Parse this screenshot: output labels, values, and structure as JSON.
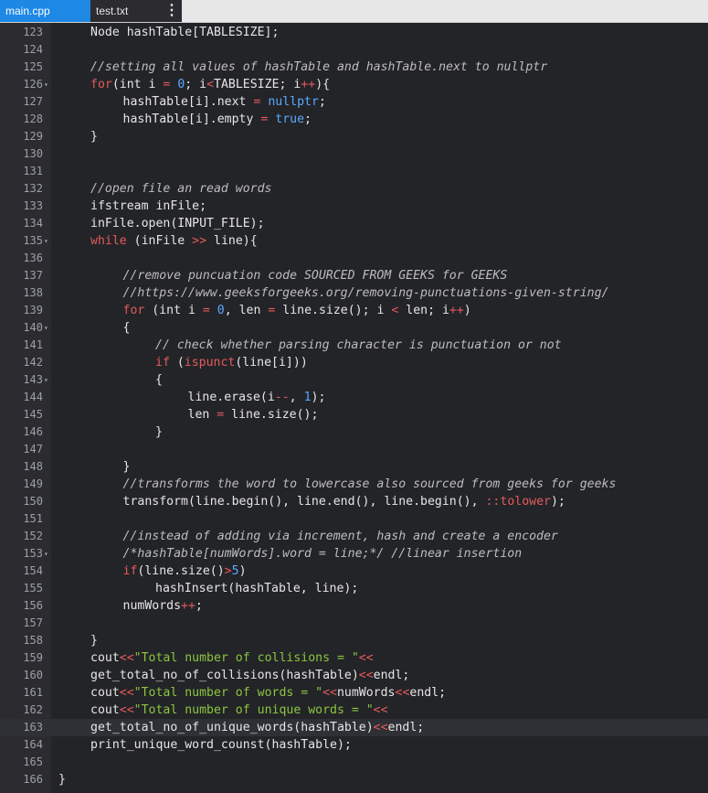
{
  "tabs": [
    {
      "label": "main.cpp",
      "active": true
    },
    {
      "label": "test.txt",
      "active": false
    }
  ],
  "tab_menu_icon": "kebab-menu-icon",
  "colors": {
    "active_tab": "#1e88e5",
    "editor_bg": "#232428",
    "gutter_bg": "#2c2c30",
    "keyword": "#e55a5a",
    "literal": "#5aa8ff",
    "string": "#8cc63e",
    "comment": "#bdbdbd"
  },
  "editor": {
    "active_line": 163,
    "lines": [
      {
        "n": "123",
        "fold": false,
        "indent": 1,
        "tokens": [
          {
            "t": "plain",
            "v": "Node hashTable[TABLESIZE];"
          }
        ]
      },
      {
        "n": "124",
        "fold": false,
        "indent": 0,
        "tokens": []
      },
      {
        "n": "125",
        "fold": false,
        "indent": 1,
        "tokens": [
          {
            "t": "com",
            "v": "//setting all values of hashTable and hashTable.next to nullptr"
          }
        ]
      },
      {
        "n": "126",
        "fold": true,
        "indent": 1,
        "tokens": [
          {
            "t": "kw",
            "v": "for"
          },
          {
            "t": "plain",
            "v": "(int i "
          },
          {
            "t": "op",
            "v": "="
          },
          {
            "t": "plain",
            "v": " "
          },
          {
            "t": "lit",
            "v": "0"
          },
          {
            "t": "plain",
            "v": "; i"
          },
          {
            "t": "op",
            "v": "<"
          },
          {
            "t": "plain",
            "v": "TABLESIZE; i"
          },
          {
            "t": "op",
            "v": "++"
          },
          {
            "t": "plain",
            "v": "){"
          }
        ]
      },
      {
        "n": "127",
        "fold": false,
        "indent": 2,
        "tokens": [
          {
            "t": "plain",
            "v": "hashTable[i].next "
          },
          {
            "t": "op",
            "v": "="
          },
          {
            "t": "plain",
            "v": " "
          },
          {
            "t": "lit",
            "v": "nullptr"
          },
          {
            "t": "plain",
            "v": ";"
          }
        ]
      },
      {
        "n": "128",
        "fold": false,
        "indent": 2,
        "tokens": [
          {
            "t": "plain",
            "v": "hashTable[i].empty "
          },
          {
            "t": "op",
            "v": "="
          },
          {
            "t": "plain",
            "v": " "
          },
          {
            "t": "lit",
            "v": "true"
          },
          {
            "t": "plain",
            "v": ";"
          }
        ]
      },
      {
        "n": "129",
        "fold": false,
        "indent": 1,
        "tokens": [
          {
            "t": "plain",
            "v": "}"
          }
        ]
      },
      {
        "n": "130",
        "fold": false,
        "indent": 0,
        "tokens": []
      },
      {
        "n": "131",
        "fold": false,
        "indent": 0,
        "tokens": []
      },
      {
        "n": "132",
        "fold": false,
        "indent": 1,
        "tokens": [
          {
            "t": "com",
            "v": "//open file an read words"
          }
        ]
      },
      {
        "n": "133",
        "fold": false,
        "indent": 1,
        "tokens": [
          {
            "t": "plain",
            "v": "ifstream inFile;"
          }
        ]
      },
      {
        "n": "134",
        "fold": false,
        "indent": 1,
        "tokens": [
          {
            "t": "plain",
            "v": "inFile.open(INPUT_FILE);"
          }
        ]
      },
      {
        "n": "135",
        "fold": true,
        "indent": 1,
        "tokens": [
          {
            "t": "kw",
            "v": "while"
          },
          {
            "t": "plain",
            "v": " (inFile "
          },
          {
            "t": "op",
            "v": ">>"
          },
          {
            "t": "plain",
            "v": " line){"
          }
        ]
      },
      {
        "n": "136",
        "fold": false,
        "indent": 0,
        "tokens": []
      },
      {
        "n": "137",
        "fold": false,
        "indent": 2,
        "tokens": [
          {
            "t": "com",
            "v": "//remove puncuation code SOURCED FROM GEEKS for GEEKS"
          }
        ]
      },
      {
        "n": "138",
        "fold": false,
        "indent": 2,
        "tokens": [
          {
            "t": "com",
            "v": "//https://www.geeksforgeeks.org/removing-punctuations-given-string/"
          }
        ]
      },
      {
        "n": "139",
        "fold": false,
        "indent": 2,
        "tokens": [
          {
            "t": "kw",
            "v": "for"
          },
          {
            "t": "plain",
            "v": " (int i "
          },
          {
            "t": "op",
            "v": "="
          },
          {
            "t": "plain",
            "v": " "
          },
          {
            "t": "lit",
            "v": "0"
          },
          {
            "t": "plain",
            "v": ", len "
          },
          {
            "t": "op",
            "v": "="
          },
          {
            "t": "plain",
            "v": " line.size(); i "
          },
          {
            "t": "op",
            "v": "<"
          },
          {
            "t": "plain",
            "v": " len; i"
          },
          {
            "t": "op",
            "v": "++"
          },
          {
            "t": "plain",
            "v": ")"
          }
        ]
      },
      {
        "n": "140",
        "fold": true,
        "indent": 2,
        "tokens": [
          {
            "t": "plain",
            "v": "{"
          }
        ]
      },
      {
        "n": "141",
        "fold": false,
        "indent": 3,
        "tokens": [
          {
            "t": "com",
            "v": "// check whether parsing character is punctuation or not"
          }
        ]
      },
      {
        "n": "142",
        "fold": false,
        "indent": 3,
        "tokens": [
          {
            "t": "kw",
            "v": "if"
          },
          {
            "t": "plain",
            "v": " ("
          },
          {
            "t": "fn",
            "v": "ispunct"
          },
          {
            "t": "plain",
            "v": "(line[i]))"
          }
        ]
      },
      {
        "n": "143",
        "fold": true,
        "indent": 3,
        "tokens": [
          {
            "t": "plain",
            "v": "{"
          }
        ]
      },
      {
        "n": "144",
        "fold": false,
        "indent": 4,
        "tokens": [
          {
            "t": "plain",
            "v": "line.erase(i"
          },
          {
            "t": "op",
            "v": "--"
          },
          {
            "t": "plain",
            "v": ", "
          },
          {
            "t": "lit",
            "v": "1"
          },
          {
            "t": "plain",
            "v": ");"
          }
        ]
      },
      {
        "n": "145",
        "fold": false,
        "indent": 4,
        "tokens": [
          {
            "t": "plain",
            "v": "len "
          },
          {
            "t": "op",
            "v": "="
          },
          {
            "t": "plain",
            "v": " line.size();"
          }
        ]
      },
      {
        "n": "146",
        "fold": false,
        "indent": 3,
        "tokens": [
          {
            "t": "plain",
            "v": "}"
          }
        ]
      },
      {
        "n": "147",
        "fold": false,
        "indent": 0,
        "tokens": []
      },
      {
        "n": "148",
        "fold": false,
        "indent": 2,
        "tokens": [
          {
            "t": "plain",
            "v": "}"
          }
        ]
      },
      {
        "n": "149",
        "fold": false,
        "indent": 2,
        "tokens": [
          {
            "t": "com",
            "v": "//transforms the word to lowercase also sourced from geeks for geeks"
          }
        ]
      },
      {
        "n": "150",
        "fold": false,
        "indent": 2,
        "tokens": [
          {
            "t": "plain",
            "v": "transform(line.begin(), line.end(), line.begin(), "
          },
          {
            "t": "op",
            "v": "::"
          },
          {
            "t": "fn",
            "v": "tolower"
          },
          {
            "t": "plain",
            "v": ");"
          }
        ]
      },
      {
        "n": "151",
        "fold": false,
        "indent": 0,
        "tokens": []
      },
      {
        "n": "152",
        "fold": false,
        "indent": 2,
        "tokens": [
          {
            "t": "com",
            "v": "//instead of adding via increment, hash and create a encoder"
          }
        ]
      },
      {
        "n": "153",
        "fold": true,
        "indent": 2,
        "tokens": [
          {
            "t": "com",
            "v": "/*hashTable[numWords].word = line;*/ //linear insertion"
          }
        ]
      },
      {
        "n": "154",
        "fold": false,
        "indent": 2,
        "tokens": [
          {
            "t": "kw",
            "v": "if"
          },
          {
            "t": "plain",
            "v": "(line.size()"
          },
          {
            "t": "op",
            "v": ">"
          },
          {
            "t": "lit",
            "v": "5"
          },
          {
            "t": "plain",
            "v": ")"
          }
        ]
      },
      {
        "n": "155",
        "fold": false,
        "indent": 3,
        "tokens": [
          {
            "t": "plain",
            "v": "hashInsert(hashTable, line);"
          }
        ]
      },
      {
        "n": "156",
        "fold": false,
        "indent": 2,
        "tokens": [
          {
            "t": "plain",
            "v": "numWords"
          },
          {
            "t": "op",
            "v": "++"
          },
          {
            "t": "plain",
            "v": ";"
          }
        ]
      },
      {
        "n": "157",
        "fold": false,
        "indent": 0,
        "tokens": []
      },
      {
        "n": "158",
        "fold": false,
        "indent": 1,
        "tokens": [
          {
            "t": "plain",
            "v": "}"
          }
        ]
      },
      {
        "n": "159",
        "fold": false,
        "indent": 1,
        "tokens": [
          {
            "t": "plain",
            "v": "cout"
          },
          {
            "t": "op",
            "v": "<<"
          },
          {
            "t": "str",
            "v": "\"Total number of collisions = \""
          },
          {
            "t": "op",
            "v": "<<"
          }
        ]
      },
      {
        "n": "160",
        "fold": false,
        "indent": 1,
        "tokens": [
          {
            "t": "plain",
            "v": "get_total_no_of_collisions(hashTable)"
          },
          {
            "t": "op",
            "v": "<<"
          },
          {
            "t": "plain",
            "v": "endl;"
          }
        ]
      },
      {
        "n": "161",
        "fold": false,
        "indent": 1,
        "tokens": [
          {
            "t": "plain",
            "v": "cout"
          },
          {
            "t": "op",
            "v": "<<"
          },
          {
            "t": "str",
            "v": "\"Total number of words = \""
          },
          {
            "t": "op",
            "v": "<<"
          },
          {
            "t": "plain",
            "v": "numWords"
          },
          {
            "t": "op",
            "v": "<<"
          },
          {
            "t": "plain",
            "v": "endl;"
          }
        ]
      },
      {
        "n": "162",
        "fold": false,
        "indent": 1,
        "tokens": [
          {
            "t": "plain",
            "v": "cout"
          },
          {
            "t": "op",
            "v": "<<"
          },
          {
            "t": "str",
            "v": "\"Total number of unique words = \""
          },
          {
            "t": "op",
            "v": "<<"
          }
        ]
      },
      {
        "n": "163",
        "fold": false,
        "indent": 1,
        "tokens": [
          {
            "t": "plain",
            "v": "get_total_no_of_unique_words(hashTable)"
          },
          {
            "t": "op",
            "v": "<<"
          },
          {
            "t": "plain",
            "v": "endl;"
          }
        ]
      },
      {
        "n": "164",
        "fold": false,
        "indent": 1,
        "tokens": [
          {
            "t": "plain",
            "v": "print_unique_word_counst(hashTable);"
          }
        ]
      },
      {
        "n": "165",
        "fold": false,
        "indent": 0,
        "tokens": []
      },
      {
        "n": "166",
        "fold": false,
        "indent": 0,
        "tokens": [
          {
            "t": "plain",
            "v": "}"
          }
        ]
      }
    ]
  }
}
